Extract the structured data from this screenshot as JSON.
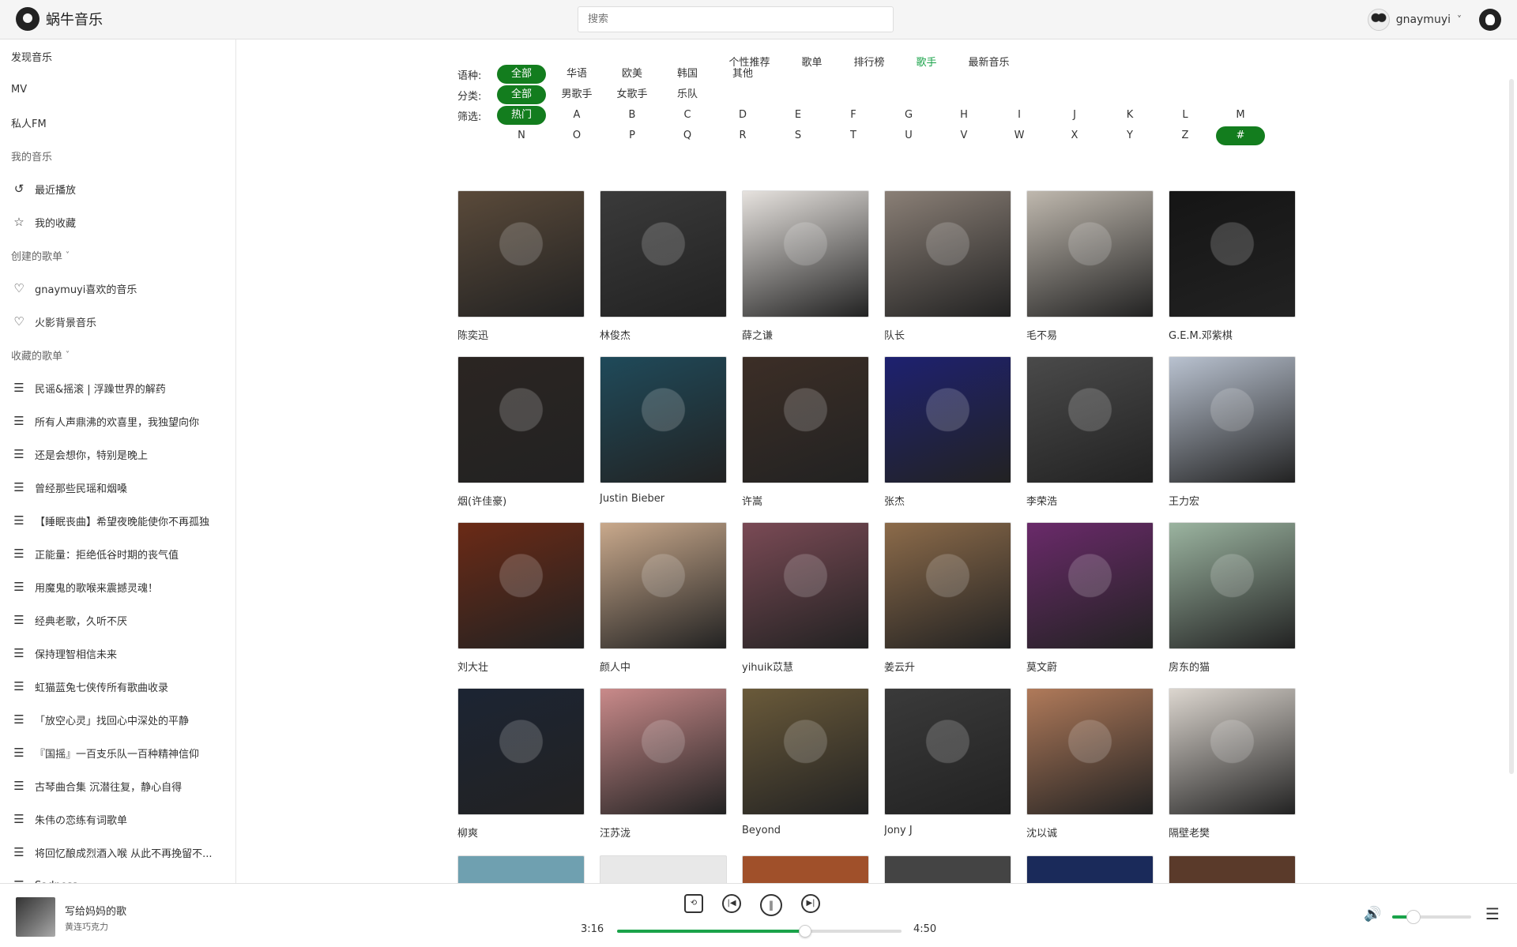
{
  "app": {
    "name": "蜗牛音乐"
  },
  "search": {
    "placeholder": "搜索"
  },
  "user": {
    "name": "gnaymuyi"
  },
  "sidebar": {
    "items": [
      {
        "label": "发现音乐",
        "icon": "",
        "kind": "nav"
      },
      {
        "label": "MV",
        "icon": "",
        "kind": "nav"
      },
      {
        "label": "私人FM",
        "icon": "",
        "kind": "nav"
      },
      {
        "label": "我的音乐",
        "icon": "",
        "kind": "section"
      },
      {
        "label": "最近播放",
        "icon": "history-icon",
        "glyph": "↺",
        "kind": "nav"
      },
      {
        "label": "我的收藏",
        "icon": "star-box-icon",
        "glyph": "☆",
        "kind": "nav"
      },
      {
        "label": "创建的歌单",
        "icon": "",
        "kind": "section",
        "arrow": "˅"
      },
      {
        "label": "gnaymuyi喜欢的音乐",
        "icon": "heart-icon",
        "glyph": "♡",
        "kind": "nav"
      },
      {
        "label": "火影背景音乐",
        "icon": "heart-icon",
        "glyph": "♡",
        "kind": "nav"
      },
      {
        "label": "收藏的歌单",
        "icon": "",
        "kind": "section",
        "arrow": "˅"
      },
      {
        "label": "民谣&摇滚 | 浮躁世界的解药",
        "icon": "playlist-icon",
        "glyph": "☰",
        "kind": "nav"
      },
      {
        "label": "所有人声鼎沸的欢喜里，我独望向你",
        "icon": "playlist-icon",
        "glyph": "☰",
        "kind": "nav"
      },
      {
        "label": "还是会想你，特别是晚上",
        "icon": "playlist-icon",
        "glyph": "☰",
        "kind": "nav"
      },
      {
        "label": "曾经那些民瑶和烟嗓",
        "icon": "playlist-icon",
        "glyph": "☰",
        "kind": "nav"
      },
      {
        "label": "【睡眠丧曲】希望夜晚能使你不再孤独",
        "icon": "playlist-icon",
        "glyph": "☰",
        "kind": "nav"
      },
      {
        "label": "正能量：拒绝低谷时期的丧气值",
        "icon": "playlist-icon",
        "glyph": "☰",
        "kind": "nav"
      },
      {
        "label": "用魔鬼的歌喉来震撼灵魂！",
        "icon": "playlist-icon",
        "glyph": "☰",
        "kind": "nav"
      },
      {
        "label": "经典老歌，久听不厌",
        "icon": "playlist-icon",
        "glyph": "☰",
        "kind": "nav"
      },
      {
        "label": "保持理智相信未来",
        "icon": "playlist-icon",
        "glyph": "☰",
        "kind": "nav"
      },
      {
        "label": "虹猫蓝兔七侠传所有歌曲收录",
        "icon": "playlist-icon",
        "glyph": "☰",
        "kind": "nav"
      },
      {
        "label": "「放空心灵」找回心中深处的平静",
        "icon": "playlist-icon",
        "glyph": "☰",
        "kind": "nav"
      },
      {
        "label": "『国摇』一百支乐队一百种精神信仰",
        "icon": "playlist-icon",
        "glyph": "☰",
        "kind": "nav"
      },
      {
        "label": "古琴曲合集 沉潜往复，静心自得",
        "icon": "playlist-icon",
        "glyph": "☰",
        "kind": "nav"
      },
      {
        "label": "朱伟の恋练有词歌单",
        "icon": "playlist-icon",
        "glyph": "☰",
        "kind": "nav"
      },
      {
        "label": "将回忆酿成烈酒入喉 从此不再挽留不...",
        "icon": "playlist-icon",
        "glyph": "☰",
        "kind": "nav"
      },
      {
        "label": "Sadness",
        "icon": "playlist-icon",
        "glyph": "☰",
        "kind": "nav"
      }
    ]
  },
  "tabs": [
    {
      "label": "个性推荐",
      "active": false
    },
    {
      "label": "歌单",
      "active": false
    },
    {
      "label": "排行榜",
      "active": false
    },
    {
      "label": "歌手",
      "active": true
    },
    {
      "label": "最新音乐",
      "active": false
    }
  ],
  "filters": {
    "language": {
      "label": "语种:",
      "options": [
        "全部",
        "华语",
        "欧美",
        "韩国",
        "其他"
      ],
      "active": 0
    },
    "category": {
      "label": "分类:",
      "options": [
        "全部",
        "男歌手",
        "女歌手",
        "乐队"
      ],
      "active": 0
    },
    "screen": {
      "label": "筛选:",
      "first": "热门",
      "row1": [
        "A",
        "B",
        "C",
        "D",
        "E",
        "F",
        "G",
        "H",
        "I",
        "J",
        "K",
        "L",
        "M"
      ],
      "row2": [
        "N",
        "O",
        "P",
        "Q",
        "R",
        "S",
        "T",
        "U",
        "V",
        "W",
        "X",
        "Y",
        "Z",
        "#"
      ],
      "active_row2": 13
    }
  },
  "artists": [
    {
      "name": "陈奕迅",
      "bg": "#5a4a3a"
    },
    {
      "name": "林俊杰",
      "bg": "#3a3a3a"
    },
    {
      "name": "薛之谦",
      "bg": "#e6e2de"
    },
    {
      "name": "队长",
      "bg": "#8a7f76"
    },
    {
      "name": "毛不易",
      "bg": "#bfb8ae"
    },
    {
      "name": "G.E.M.邓紫棋",
      "bg": "#151515"
    },
    {
      "name": "烟(许佳豪)",
      "bg": "#2b2522"
    },
    {
      "name": "Justin Bieber",
      "bg": "#1f4a5a"
    },
    {
      "name": "许嵩",
      "bg": "#3c2e26"
    },
    {
      "name": "张杰",
      "bg": "#1e2170"
    },
    {
      "name": "李荣浩",
      "bg": "#4a4a4a"
    },
    {
      "name": "王力宏",
      "bg": "#b9c2d0"
    },
    {
      "name": "刘大壮",
      "bg": "#6b2a16"
    },
    {
      "name": "颜人中",
      "bg": "#c9a98c"
    },
    {
      "name": "yihuik苡慧",
      "bg": "#7a4a55"
    },
    {
      "name": "姜云升",
      "bg": "#8c6b4a"
    },
    {
      "name": "莫文蔚",
      "bg": "#6a2a6a"
    },
    {
      "name": "房东的猫",
      "bg": "#9bb4a0"
    },
    {
      "name": "柳爽",
      "bg": "#1c2433"
    },
    {
      "name": "汪苏泷",
      "bg": "#c98a8a"
    },
    {
      "name": "Beyond",
      "bg": "#6a5a3a"
    },
    {
      "name": "Jony J",
      "bg": "#3a3a3a"
    },
    {
      "name": "沈以诚",
      "bg": "#b07a5a"
    },
    {
      "name": "隔壁老樊",
      "bg": "#dcd6cf"
    }
  ],
  "partial_row": [
    "#6fa0b0",
    "#e8e8e8",
    "#a0502a",
    "#444444",
    "#1a2a5a",
    "#5a3a2a"
  ],
  "player": {
    "title": "写给妈妈的歌",
    "artist": "黄连巧克力",
    "current_time": "3:16",
    "total_time": "4:50",
    "progress": 0.66,
    "volume": 0.27,
    "accent": "#1aa34a"
  }
}
